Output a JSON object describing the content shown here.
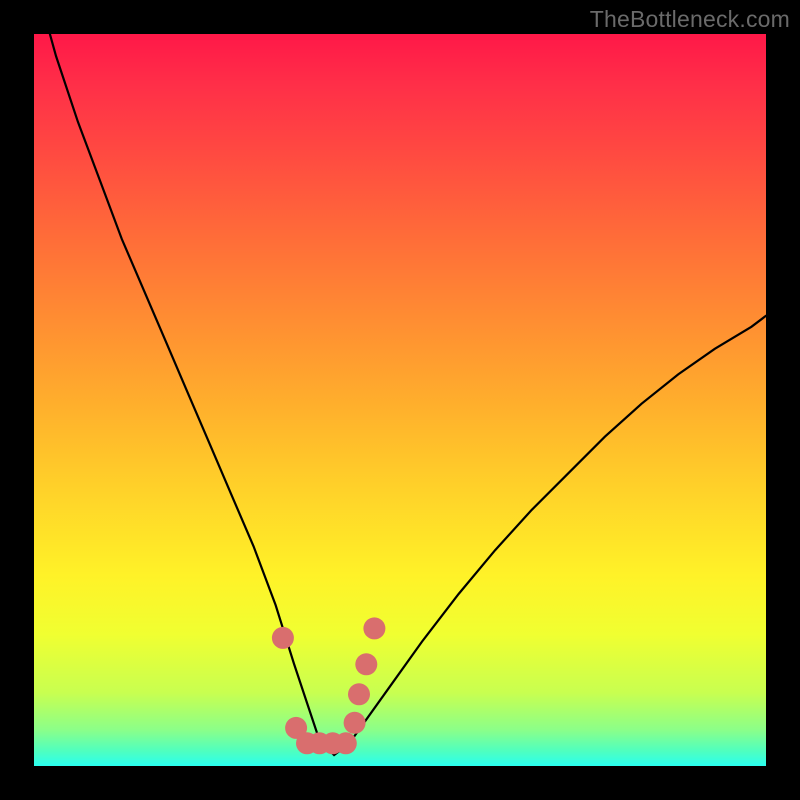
{
  "watermark": "TheBottleneck.com",
  "chart_data": {
    "type": "line",
    "title": "",
    "xlabel": "",
    "ylabel": "",
    "xlim": [
      0,
      100
    ],
    "ylim": [
      0,
      100
    ],
    "series": [
      {
        "name": "bottleneck-curve",
        "x": [
          0.5,
          3,
          6,
          9,
          12,
          15,
          18,
          21,
          24,
          27,
          30,
          33,
          35.5,
          37.5,
          39,
          41,
          43,
          48,
          53,
          58,
          63,
          68,
          73,
          78,
          83,
          88,
          93,
          98,
          100
        ],
        "values": [
          106,
          97,
          88,
          80,
          72,
          65,
          58,
          51,
          44,
          37,
          30,
          22,
          14,
          8,
          3.5,
          1.5,
          3,
          10,
          17,
          23.5,
          29.5,
          35,
          40,
          45,
          49.5,
          53.5,
          57,
          60,
          61.5
        ]
      }
    ],
    "markers": {
      "name": "highlight-dots",
      "color": "#d96e6e",
      "points": [
        {
          "x": 34.0,
          "y": 17.5
        },
        {
          "x": 35.8,
          "y": 5.2
        },
        {
          "x": 37.3,
          "y": 3.1
        },
        {
          "x": 39.0,
          "y": 3.1
        },
        {
          "x": 40.8,
          "y": 3.1
        },
        {
          "x": 42.6,
          "y": 3.1
        },
        {
          "x": 43.8,
          "y": 5.9
        },
        {
          "x": 44.4,
          "y": 9.8
        },
        {
          "x": 45.4,
          "y": 13.9
        },
        {
          "x": 46.5,
          "y": 18.8
        }
      ]
    }
  }
}
